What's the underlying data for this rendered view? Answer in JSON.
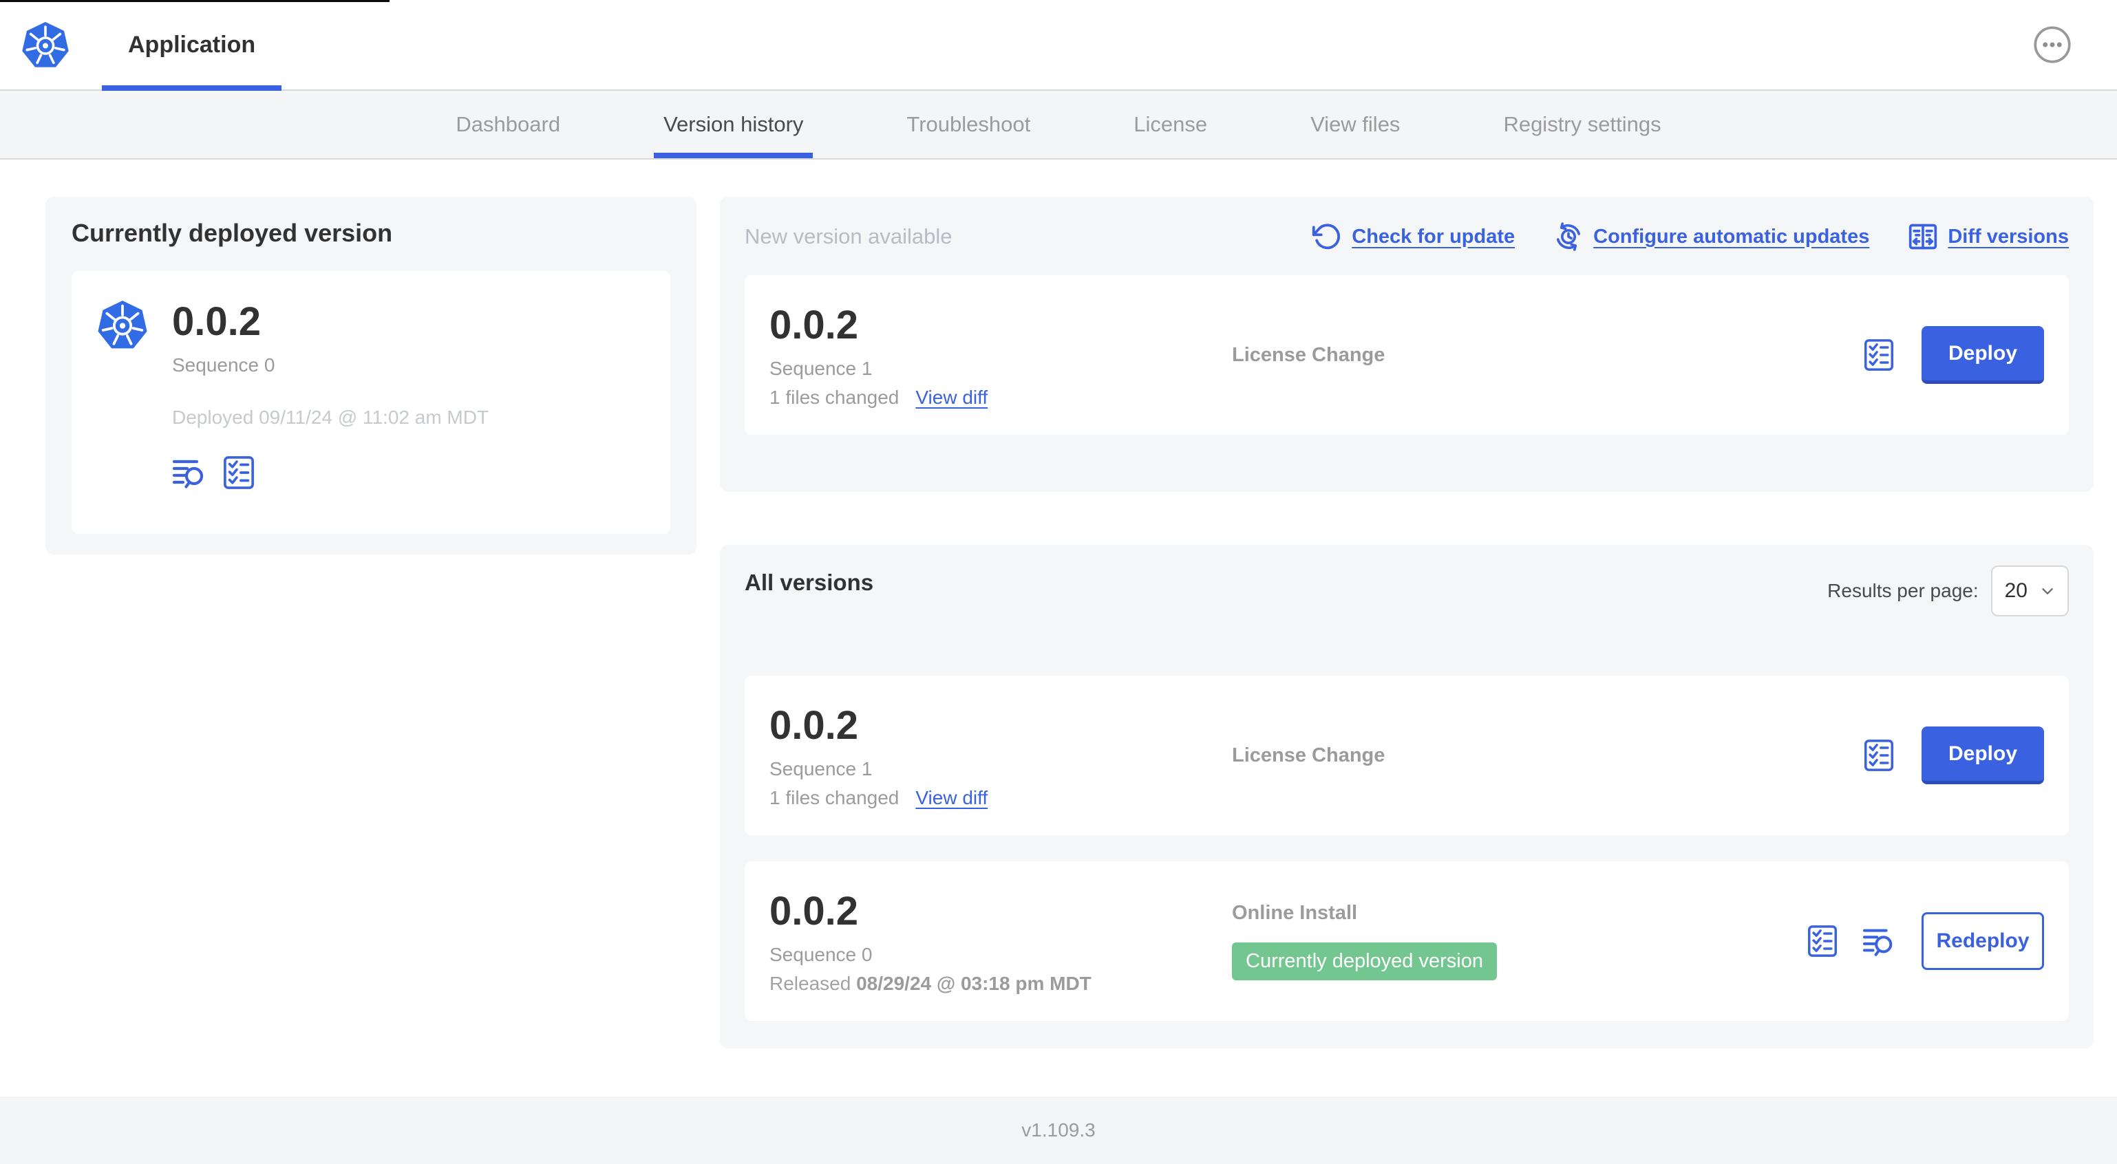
{
  "header": {
    "title": "Application"
  },
  "nav": {
    "tabs": [
      {
        "label": "Dashboard"
      },
      {
        "label": "Version history"
      },
      {
        "label": "Troubleshoot"
      },
      {
        "label": "License"
      },
      {
        "label": "View files"
      },
      {
        "label": "Registry settings"
      }
    ]
  },
  "current_version": {
    "heading": "Currently deployed version",
    "version": "0.0.2",
    "sequence": "Sequence 0",
    "deployed": "Deployed 09/11/24 @ 11:02 am MDT"
  },
  "new_version": {
    "heading": "New version available",
    "actions": [
      {
        "label": "Check for update",
        "icon": "refresh-icon"
      },
      {
        "label": "Configure automatic updates",
        "icon": "schedule-icon"
      },
      {
        "label": "Diff versions",
        "icon": "diff-icon"
      }
    ],
    "card": {
      "version": "0.0.2",
      "sequence": "Sequence 1",
      "files_changed": "1 files changed",
      "view_diff_label": "View diff",
      "source": "License Change",
      "action_label": "Deploy"
    }
  },
  "all_versions": {
    "heading": "All versions",
    "results_per_page_label": "Results per page:",
    "results_per_page_value": "20",
    "rows": [
      {
        "version": "0.0.2",
        "sequence": "Sequence 1",
        "files_changed": "1 files changed",
        "view_diff_label": "View diff",
        "source": "License Change",
        "action_label": "Deploy"
      },
      {
        "version": "0.0.2",
        "sequence": "Sequence 0",
        "released_label": "Released",
        "released_date": "08/29/24 @ 03:18 pm MDT",
        "source": "Online Install",
        "badge": "Currently deployed version",
        "action_label": "Redeploy"
      }
    ]
  },
  "footer": {
    "app_manager_version": "v1.109.3"
  },
  "colors": {
    "accent": "#3a62e0",
    "k8s_blue": "#326ce5",
    "badge_green": "#74c690",
    "panel_bg": "#f5f6f8"
  }
}
